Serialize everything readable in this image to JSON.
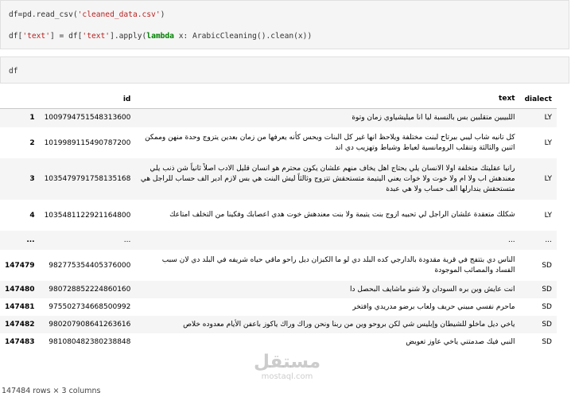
{
  "cell1": {
    "line1": {
      "a": "df=pd.read_csv(",
      "str": "'cleaned_data.csv'",
      "b": ")"
    },
    "line2": {
      "a": "df[",
      "s1": "'text'",
      "b": "] = df[",
      "s2": "'text'",
      "c": "].apply(",
      "kw": "lambda",
      "d": " x: ArabicCleaning().clean(x))"
    }
  },
  "cell2": {
    "line1": "df"
  },
  "table": {
    "columns": {
      "index": "",
      "id": "id",
      "text": "text",
      "dialect": "dialect"
    },
    "rows": [
      {
        "index": "1",
        "id": "1009794751548313600",
        "text": "اللبيبين متقلبين بس بالنسبة ليا انا ميليشياوي زمان وتوة",
        "dialect": "LY"
      },
      {
        "index": "2",
        "id": "1019989115490787200",
        "text": "كل تانيه شاب ليبي بيرتاح لبنت مختلفة ويلاحظ انها غير كل البنات ويحس كأنه يعرفها من زمان بعدين يتزوج وحدة منهن وممكن اثنين والثالثة وتنقلب الرومانسية لعياط وشياط وتهزيب دي اند",
        "dialect": "LY"
      },
      {
        "index": "3",
        "id": "1035479791758135168",
        "text": "رانيا عقليتك متخلفة اولا الانسان يلي يحتاج اهل يخاف منهم علشان يكون محترم هو انسان قليل الادب اصلاً ثانياً شن ذنب يلي معندهش اب ولا ام ولا خوت ولا خوات يعني اليتيمة متستحقش تتزوج وثالثاً ليش البنت هي بس لازم ادير الف حساب للراجل هي متستحقش يندارلها الف حساب ولا هي عبدة",
        "dialect": "LY"
      },
      {
        "index": "4",
        "id": "1035481122921164800",
        "text": "شكلك متعقدة علشان الراجل لي تحبيه ازوج بنت يتيمة ولا بنت معندهش خوت هدي اعصابك وفكينا من التخلف امتاعك",
        "dialect": "LY"
      },
      {
        "index": "...",
        "id": "...",
        "text": "...",
        "dialect": "..."
      },
      {
        "index": "147479",
        "id": "982775354405376000",
        "text": "الناس دي بتتفج في قرية مقدودة بالدارجي كده البلد دي لو ما الكبزان ديل راحو ماقي حياه شريفه في البلد دي لان سبب الفساد والمصائب الموجودة",
        "dialect": "SD"
      },
      {
        "index": "147480",
        "id": "980728852224860160",
        "text": "انت عايش وين بره السودان ولا شنو ماشايف البحصل دا",
        "dialect": "SD"
      },
      {
        "index": "147481",
        "id": "975502734668500992",
        "text": "ماحرم نفسي مبيني حريف ولعاب برضو مدريدي وافتخر",
        "dialect": "SD"
      },
      {
        "index": "147482",
        "id": "980207908641263616",
        "text": "ياخي ديل ماخلو للشيطان وإبليس شي لكن بروحو وين من ربنا ونحن وراك وراك ياكوز باعفن الأيام معدوده خلاص",
        "dialect": "SD"
      },
      {
        "index": "147483",
        "id": "981080482380238848",
        "text": "النبي فيك صدمتني ياخي عاوز تعويض",
        "dialect": "SD"
      }
    ]
  },
  "footer": "147484 rows × 3 columns",
  "watermark": {
    "arabic": "مستقل",
    "latin": "mostaql.com"
  }
}
